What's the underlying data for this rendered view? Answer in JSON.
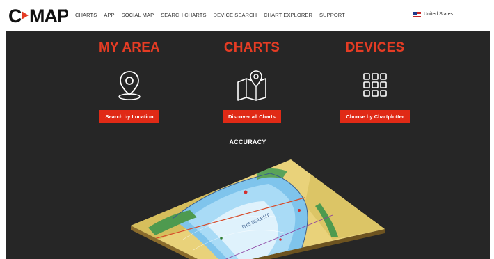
{
  "brand": {
    "logo_text": "C-MAP"
  },
  "nav": {
    "items": [
      "CHARTS",
      "APP",
      "SOCIAL MAP",
      "SEARCH CHARTS",
      "DEVICE SEARCH",
      "CHART EXPLORER",
      "SUPPORT"
    ],
    "locale": "United States"
  },
  "sections": [
    {
      "title": "MY AREA",
      "icon": "location-pin-icon",
      "button": "Search by Location"
    },
    {
      "title": "CHARTS",
      "icon": "map-pin-icon",
      "button": "Discover all Charts"
    },
    {
      "title": "DEVICES",
      "icon": "grid-icon",
      "button": "Choose by Chartplotter"
    }
  ],
  "accuracy_label": "ACCURACY",
  "colors": {
    "accent": "#e53c24",
    "button": "#e02a16",
    "panel": "#262626"
  }
}
